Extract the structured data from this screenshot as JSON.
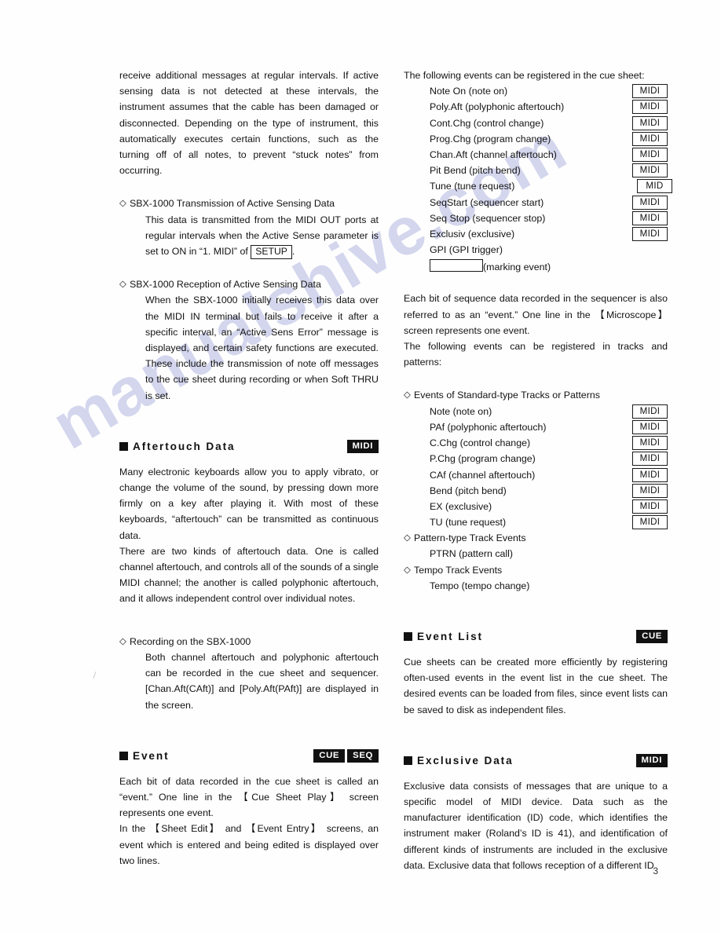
{
  "page": {
    "number": "3",
    "watermark": "manualshive.com"
  },
  "left_column": {
    "intro_paragraph": "receive additional messages at regular intervals. If active sensing data is not detected at these intervals, the instrument assumes that the cable has been damaged or disconnected. Depending on the type of instrument, this automatically executes certain functions, such as the turning off of all notes, to prevent “stuck notes” from occurring.",
    "transmission_section": {
      "heading": "SBX-1000 Transmission of Active Sensing Data",
      "body_before_box": "This data is transmitted from the MIDI OUT ports at regular intervals when the Active Sense parameter is set to ON in “1. MIDI” of",
      "boxed_keyword": "SETUP",
      "body_after_box": "."
    },
    "reception_section": {
      "heading": "SBX-1000 Reception of Active Sensing Data",
      "body": "When the SBX-1000 initially receives this data over the MIDI IN terminal but fails to receive it after a specific interval, an “Active Sens Error” message is displayed, and certain safety functions are executed. These include the transmission of note off messages to the cue sheet during recording or when Soft THRU is set."
    },
    "aftertouch_section": {
      "title": "Aftertouch Data",
      "badges": [
        "MIDI"
      ],
      "paragraph_1": "Many electronic keyboards allow you to apply vibrato, or change the volume of the sound, by pressing down more firmly on a key after playing it. With most of these keyboards, “aftertouch” can be transmitted as continuous data.",
      "paragraph_2": "There are two kinds of aftertouch data. One is called channel aftertouch, and controls all of the sounds of a single MIDI channel; the another is called polyphonic aftertouch, and it allows independent control over individual notes.",
      "recording_heading": "Recording on the SBX-1000",
      "recording_body": "Both channel aftertouch and polyphonic aftertouch can be recorded in the cue sheet and sequencer. [Chan.Aft(CAft)] and [Poly.Aft(PAft)] are displayed in the screen."
    },
    "event_section": {
      "title": "Event",
      "badges": [
        "CUE",
        "SEQ"
      ],
      "paragraph_1": "Each bit of data recorded in the cue sheet is called an “event.” One line in the 【Cue Sheet Play】 screen represents one event.",
      "paragraph_2": "In the 【Sheet Edit】 and 【Event Entry】 screens, an event which is entered and being edited is displayed over two lines."
    }
  },
  "right_column": {
    "cue_sheet_intro": "The following events can be registered in the cue sheet:",
    "cue_sheet_events": [
      {
        "label": "Note On (note on)",
        "badge": "MIDI"
      },
      {
        "label": "Poly.Aft (polyphonic aftertouch)",
        "badge": "MIDI"
      },
      {
        "label": "Cont.Chg (control change)",
        "badge": "MIDI"
      },
      {
        "label": "Prog.Chg (program change)",
        "badge": "MIDI"
      },
      {
        "label": "Chan.Aft (channel aftertouch)",
        "badge": "MIDI"
      },
      {
        "label": "Pit Bend (pitch bend)",
        "badge": "MIDI"
      },
      {
        "label": "Tune (tune request)",
        "badge": "MID"
      },
      {
        "label": "SeqStart (sequencer start)",
        "badge": "MIDI"
      },
      {
        "label": "Seq Stop (sequencer stop)",
        "badge": "MIDI"
      },
      {
        "label": "Exclusiv (exclusive)",
        "badge": "MIDI"
      },
      {
        "label": "GPI (GPI trigger)",
        "badge": ""
      }
    ],
    "marking_event_label": "(marking event)",
    "sequencer_paragraph_1": "Each bit of sequence data recorded in the sequencer is also referred to as an “event.” One line in the 【Microscope】 screen represents one event.",
    "sequencer_paragraph_2": "The following events can be registered in tracks and patterns:",
    "standard_track_heading": "Events of Standard-type Tracks or Patterns",
    "standard_track_events": [
      {
        "label": "Note (note on)",
        "badge": "MIDI"
      },
      {
        "label": "PAf (polyphonic aftertouch)",
        "badge": "MIDI"
      },
      {
        "label": "C.Chg (control change)",
        "badge": "MIDI"
      },
      {
        "label": "P.Chg (program change)",
        "badge": "MIDI"
      },
      {
        "label": "CAf (channel aftertouch)",
        "badge": "MIDI"
      },
      {
        "label": "Bend (pitch bend)",
        "badge": "MIDI"
      },
      {
        "label": "EX (exclusive)",
        "badge": "MIDI"
      },
      {
        "label": "TU (tune request)",
        "badge": "MIDI"
      }
    ],
    "pattern_track_heading": "Pattern-type Track Events",
    "pattern_track_item": "PTRN (pattern call)",
    "tempo_track_heading": "Tempo Track Events",
    "tempo_track_item": "Tempo (tempo change)",
    "event_list_section": {
      "title": "Event List",
      "badges": [
        "CUE"
      ],
      "paragraph": "Cue sheets can be created more efficiently by registering often-used events in the event list in the cue sheet. The desired events can be loaded from files, since event lists can be saved to disk as independent files."
    },
    "exclusive_data_section": {
      "title": "Exclusive Data",
      "badges": [
        "MIDI"
      ],
      "paragraph": "Exclusive data consists of messages that are unique to a specific model of MIDI device. Data such as the manufacturer identification (ID) code, which identifies the instrument maker (Roland’s ID is 41), and identification of different kinds of instruments are included in the exclusive data. Exclusive data that follows reception of a different ID"
    }
  }
}
